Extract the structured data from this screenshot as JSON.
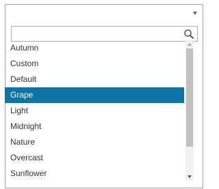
{
  "dropdown": {
    "selected_display": "",
    "search": {
      "value": "",
      "placeholder": ""
    },
    "options": [
      {
        "label": "Autumn",
        "selected": false
      },
      {
        "label": "Custom",
        "selected": false
      },
      {
        "label": "Default",
        "selected": false
      },
      {
        "label": "Grape",
        "selected": true
      },
      {
        "label": "Light",
        "selected": false
      },
      {
        "label": "Midnight",
        "selected": false
      },
      {
        "label": "Nature",
        "selected": false
      },
      {
        "label": "Overcast",
        "selected": false
      },
      {
        "label": "Sunflower",
        "selected": false
      }
    ],
    "scroll_position": 0.05
  },
  "icons": {
    "caret": "chevron-down-icon",
    "search": "search-icon"
  },
  "colors": {
    "selected_bg": "#0e74a8",
    "selected_text": "#ffffff",
    "text": "#333333",
    "border": "#a0a0a0"
  }
}
